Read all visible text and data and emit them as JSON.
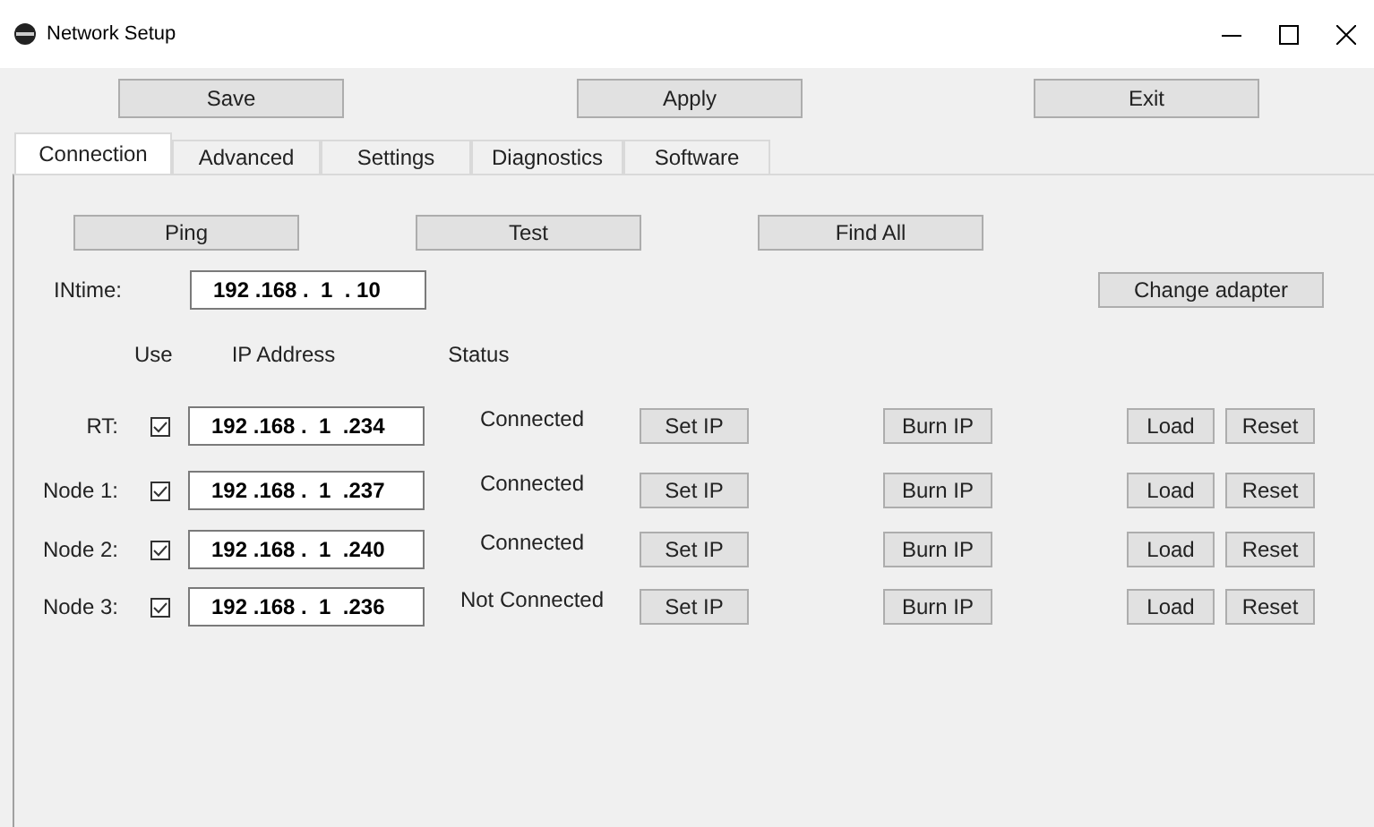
{
  "window": {
    "title": "Network Setup"
  },
  "toolbar": [
    "Save",
    "Apply",
    "Exit"
  ],
  "tabs": [
    {
      "label": "Connection",
      "selected": true
    },
    {
      "label": "Advanced",
      "selected": false
    },
    {
      "label": "Settings",
      "selected": false
    },
    {
      "label": "Diagnostics",
      "selected": false
    },
    {
      "label": "Software",
      "selected": false
    }
  ],
  "actions": [
    "Ping",
    "Test",
    "Find All"
  ],
  "intime": {
    "label": "INtime:",
    "value": "192 .168 .  1  . 10"
  },
  "change_adapter": "Change adapter",
  "columns": [
    "Use",
    "IP Address",
    "Status"
  ],
  "nodes": [
    {
      "label": "RT:",
      "checked": true,
      "ip": "192 .168 .  1  .234",
      "status": "Connected",
      "buttons": [
        "Set IP",
        "Burn IP",
        "Load",
        "Reset"
      ]
    },
    {
      "label": "Node 1:",
      "checked": true,
      "ip": "192 .168 .  1  .237",
      "status": "Connected",
      "buttons": [
        "Set IP",
        "Burn IP",
        "Load",
        "Reset"
      ]
    },
    {
      "label": "Node 2:",
      "checked": true,
      "ip": "192 .168 .  1  .240",
      "status": "Connected",
      "buttons": [
        "Set IP",
        "Burn IP",
        "Load",
        "Reset"
      ]
    },
    {
      "label": "Node 3:",
      "checked": true,
      "ip": "192 .168 .  1  .236",
      "status": "Not Connected",
      "buttons": [
        "Set IP",
        "Burn IP",
        "Load",
        "Reset"
      ]
    }
  ]
}
